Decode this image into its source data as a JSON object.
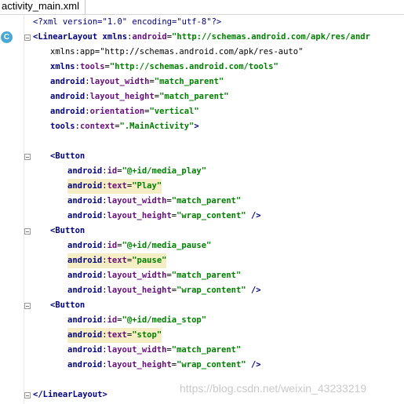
{
  "editor": {
    "tab_title": "activity_main.xml",
    "gutter_badge": "C",
    "highlight_color": "#f5eec5",
    "lines": [
      {
        "indent": 0,
        "highlight": false,
        "fold": false,
        "tokens": [
          {
            "t": "pi",
            "v": "<?xml version=\"1.0\" encoding=\"utf-8\"?>"
          }
        ]
      },
      {
        "indent": 0,
        "highlight": false,
        "fold": true,
        "tokens": [
          {
            "t": "tag",
            "v": "<LinearLayout "
          },
          {
            "t": "ns",
            "v": "xmlns"
          },
          {
            "t": "txt",
            "v": ":"
          },
          {
            "t": "attr",
            "v": "android"
          },
          {
            "t": "txt",
            "v": "="
          },
          {
            "t": "val",
            "v": "\"http://schemas.android.com/apk/res/andr"
          }
        ]
      },
      {
        "indent": 1,
        "highlight": false,
        "fold": false,
        "tokens": [
          {
            "t": "txt",
            "v": "xmlns:app=\"http://schemas.android.com/apk/res-auto\""
          }
        ]
      },
      {
        "indent": 1,
        "highlight": false,
        "fold": false,
        "tokens": [
          {
            "t": "ns",
            "v": "xmlns"
          },
          {
            "t": "txt",
            "v": ":"
          },
          {
            "t": "attr",
            "v": "tools"
          },
          {
            "t": "txt",
            "v": "="
          },
          {
            "t": "val",
            "v": "\"http://schemas.android.com/tools\""
          }
        ]
      },
      {
        "indent": 1,
        "highlight": false,
        "fold": false,
        "tokens": [
          {
            "t": "ns",
            "v": "android"
          },
          {
            "t": "txt",
            "v": ":"
          },
          {
            "t": "attr",
            "v": "layout_width"
          },
          {
            "t": "txt",
            "v": "="
          },
          {
            "t": "val",
            "v": "\"match_parent\""
          }
        ]
      },
      {
        "indent": 1,
        "highlight": false,
        "fold": false,
        "tokens": [
          {
            "t": "ns",
            "v": "android"
          },
          {
            "t": "txt",
            "v": ":"
          },
          {
            "t": "attr",
            "v": "layout_height"
          },
          {
            "t": "txt",
            "v": "="
          },
          {
            "t": "val",
            "v": "\"match_parent\""
          }
        ]
      },
      {
        "indent": 1,
        "highlight": false,
        "fold": false,
        "tokens": [
          {
            "t": "ns",
            "v": "android"
          },
          {
            "t": "txt",
            "v": ":"
          },
          {
            "t": "attr",
            "v": "orientation"
          },
          {
            "t": "txt",
            "v": "="
          },
          {
            "t": "val",
            "v": "\"vertical\""
          }
        ]
      },
      {
        "indent": 1,
        "highlight": false,
        "fold": false,
        "tokens": [
          {
            "t": "ns",
            "v": "tools"
          },
          {
            "t": "txt",
            "v": ":"
          },
          {
            "t": "attr",
            "v": "context"
          },
          {
            "t": "txt",
            "v": "="
          },
          {
            "t": "val",
            "v": "\".MainActivity\""
          },
          {
            "t": "tag",
            "v": ">"
          }
        ]
      },
      {
        "indent": 0,
        "highlight": false,
        "fold": false,
        "tokens": []
      },
      {
        "indent": 1,
        "highlight": false,
        "fold": true,
        "tokens": [
          {
            "t": "tag",
            "v": "<Button"
          }
        ]
      },
      {
        "indent": 2,
        "highlight": false,
        "fold": false,
        "tokens": [
          {
            "t": "ns",
            "v": "android"
          },
          {
            "t": "txt",
            "v": ":"
          },
          {
            "t": "attr",
            "v": "id"
          },
          {
            "t": "txt",
            "v": "="
          },
          {
            "t": "val",
            "v": "\"@+id/media_play\""
          }
        ]
      },
      {
        "indent": 2,
        "highlight": true,
        "fold": false,
        "tokens": [
          {
            "t": "ns",
            "v": "android"
          },
          {
            "t": "txt",
            "v": ":"
          },
          {
            "t": "attr",
            "v": "text"
          },
          {
            "t": "txt",
            "v": "="
          },
          {
            "t": "val",
            "v": "\"Play\""
          }
        ]
      },
      {
        "indent": 2,
        "highlight": false,
        "fold": false,
        "tokens": [
          {
            "t": "ns",
            "v": "android"
          },
          {
            "t": "txt",
            "v": ":"
          },
          {
            "t": "attr",
            "v": "layout_width"
          },
          {
            "t": "txt",
            "v": "="
          },
          {
            "t": "val",
            "v": "\"match_parent\""
          }
        ]
      },
      {
        "indent": 2,
        "highlight": false,
        "fold": false,
        "tokens": [
          {
            "t": "ns",
            "v": "android"
          },
          {
            "t": "txt",
            "v": ":"
          },
          {
            "t": "attr",
            "v": "layout_height"
          },
          {
            "t": "txt",
            "v": "="
          },
          {
            "t": "val",
            "v": "\"wrap_content\""
          },
          {
            "t": "tag",
            "v": " />"
          }
        ]
      },
      {
        "indent": 1,
        "highlight": false,
        "fold": true,
        "tokens": [
          {
            "t": "tag",
            "v": "<Button"
          }
        ]
      },
      {
        "indent": 2,
        "highlight": false,
        "fold": false,
        "tokens": [
          {
            "t": "ns",
            "v": "android"
          },
          {
            "t": "txt",
            "v": ":"
          },
          {
            "t": "attr",
            "v": "id"
          },
          {
            "t": "txt",
            "v": "="
          },
          {
            "t": "val",
            "v": "\"@+id/media_pause\""
          }
        ]
      },
      {
        "indent": 2,
        "highlight": true,
        "fold": false,
        "tokens": [
          {
            "t": "ns",
            "v": "android"
          },
          {
            "t": "txt",
            "v": ":"
          },
          {
            "t": "attr",
            "v": "text"
          },
          {
            "t": "txt",
            "v": "="
          },
          {
            "t": "val",
            "v": "\"pause\""
          }
        ]
      },
      {
        "indent": 2,
        "highlight": false,
        "fold": false,
        "tokens": [
          {
            "t": "ns",
            "v": "android"
          },
          {
            "t": "txt",
            "v": ":"
          },
          {
            "t": "attr",
            "v": "layout_width"
          },
          {
            "t": "txt",
            "v": "="
          },
          {
            "t": "val",
            "v": "\"match_parent\""
          }
        ]
      },
      {
        "indent": 2,
        "highlight": false,
        "fold": false,
        "tokens": [
          {
            "t": "ns",
            "v": "android"
          },
          {
            "t": "txt",
            "v": ":"
          },
          {
            "t": "attr",
            "v": "layout_height"
          },
          {
            "t": "txt",
            "v": "="
          },
          {
            "t": "val",
            "v": "\"wrap_content\""
          },
          {
            "t": "tag",
            "v": " />"
          }
        ]
      },
      {
        "indent": 1,
        "highlight": false,
        "fold": true,
        "tokens": [
          {
            "t": "tag",
            "v": "<Button"
          }
        ]
      },
      {
        "indent": 2,
        "highlight": false,
        "fold": false,
        "tokens": [
          {
            "t": "ns",
            "v": "android"
          },
          {
            "t": "txt",
            "v": ":"
          },
          {
            "t": "attr",
            "v": "id"
          },
          {
            "t": "txt",
            "v": "="
          },
          {
            "t": "val",
            "v": "\"@+id/media_stop\""
          }
        ]
      },
      {
        "indent": 2,
        "highlight": true,
        "fold": false,
        "tokens": [
          {
            "t": "ns",
            "v": "android"
          },
          {
            "t": "txt",
            "v": ":"
          },
          {
            "t": "attr",
            "v": "text"
          },
          {
            "t": "txt",
            "v": "="
          },
          {
            "t": "val",
            "v": "\"stop\""
          }
        ]
      },
      {
        "indent": 2,
        "highlight": false,
        "fold": false,
        "tokens": [
          {
            "t": "ns",
            "v": "android"
          },
          {
            "t": "txt",
            "v": ":"
          },
          {
            "t": "attr",
            "v": "layout_width"
          },
          {
            "t": "txt",
            "v": "="
          },
          {
            "t": "val",
            "v": "\"match_parent\""
          }
        ]
      },
      {
        "indent": 2,
        "highlight": false,
        "fold": false,
        "tokens": [
          {
            "t": "ns",
            "v": "android"
          },
          {
            "t": "txt",
            "v": ":"
          },
          {
            "t": "attr",
            "v": "layout_height"
          },
          {
            "t": "txt",
            "v": "="
          },
          {
            "t": "val",
            "v": "\"wrap_content\""
          },
          {
            "t": "tag",
            "v": " />"
          }
        ]
      },
      {
        "indent": 0,
        "highlight": false,
        "fold": false,
        "tokens": []
      },
      {
        "indent": 0,
        "highlight": false,
        "fold": true,
        "tokens": [
          {
            "t": "tag",
            "v": "</LinearLayout>"
          }
        ]
      }
    ]
  },
  "watermark": "https://blog.csdn.net/weixin_43233219"
}
